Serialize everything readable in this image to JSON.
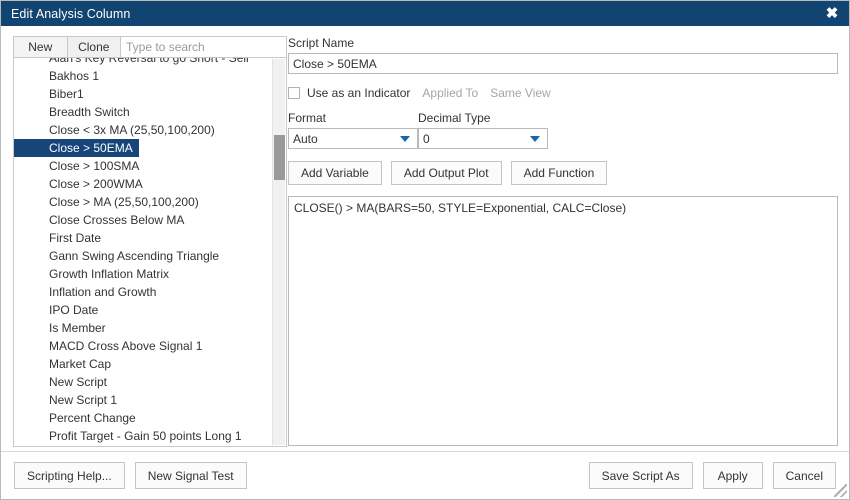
{
  "window": {
    "title": "Edit Analysis Column",
    "close_icon": "close-icon",
    "close_glyph": "✖",
    "titlebar_color": "#114470"
  },
  "left_panel": {
    "tabs": [
      {
        "label": "New",
        "active": true
      },
      {
        "label": "Clone",
        "active": false
      }
    ],
    "search": {
      "placeholder": "Type to search",
      "value": ""
    },
    "selected_item": "Close > 50EMA",
    "selection_color": "#17457a",
    "items": [
      "Alan's Key Reversal to go Short - Sell",
      "Bakhos 1",
      "Biber1",
      "Breadth Switch",
      "Close < 3x MA (25,50,100,200)",
      "Close > 50EMA",
      "Close > 100SMA",
      "Close > 200WMA",
      "Close > MA (25,50,100,200)",
      "Close Crosses Below MA",
      "First Date",
      "Gann Swing Ascending Triangle",
      "Growth Inflation Matrix",
      "Inflation and Growth",
      "IPO Date",
      "Is Member",
      "MACD Cross Above Signal 1",
      "Market Cap",
      "New Script",
      "New Script 1",
      "Percent Change",
      "Profit Target - Gain 50 points Long 1"
    ]
  },
  "right_panel": {
    "script_name_label": "Script Name",
    "script_name_value": "Close > 50EMA",
    "use_as_indicator_label": "Use as an Indicator",
    "use_as_indicator_checked": false,
    "applied_to_label": "Applied To",
    "same_view_label": "Same View",
    "format_label": "Format",
    "format_value": "Auto",
    "decimal_type_label": "Decimal Type",
    "decimal_type_value": "0",
    "action_buttons": [
      "Add Variable",
      "Add Output Plot",
      "Add Function"
    ],
    "script_text": "CLOSE() > MA(BARS=50, STYLE=Exponential, CALC=Close)"
  },
  "footer": {
    "left_buttons": [
      "Scripting Help...",
      "New Signal Test"
    ],
    "right_buttons": [
      "Save Script As",
      "Apply",
      "Cancel"
    ]
  }
}
